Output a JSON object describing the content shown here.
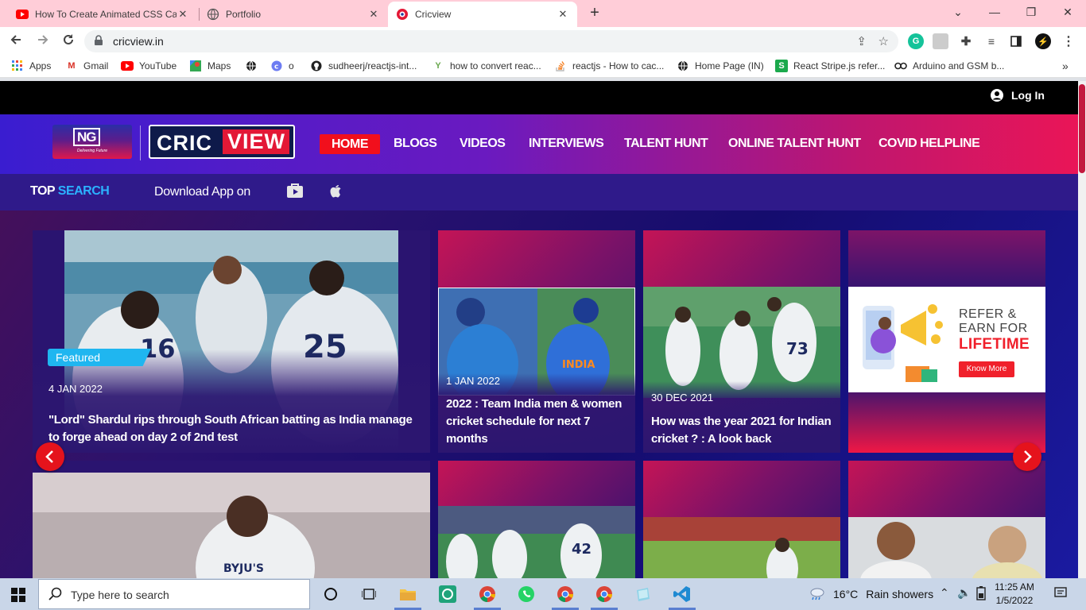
{
  "browser": {
    "tabs": [
      {
        "label": "How To Create Animated CSS Ca",
        "icon": "youtube-icon",
        "active": false
      },
      {
        "label": "Portfolio",
        "icon": "globe-icon",
        "active": false
      },
      {
        "label": "Cricview",
        "icon": "cricview-icon",
        "active": true
      }
    ],
    "url": "cricview.in",
    "bookmarks": [
      "Apps",
      "Gmail",
      "YouTube",
      "Maps",
      "",
      "o",
      "sudheerj/reactjs-int...",
      "how to convert reac...",
      "reactjs - How to cac...",
      "Home Page (IN)",
      "React Stripe.js refer...",
      "Arduino and GSM b..."
    ]
  },
  "site": {
    "login_label": "Log In",
    "logo_ng_text": "NG",
    "logo_ng_tagline": "Delivering Future",
    "logo_cric": "CRIC",
    "logo_view": "VIEW",
    "nav": [
      "HOME",
      "BLOGS",
      "VIDEOS",
      "INTERVIEWS",
      "TALENT HUNT",
      "ONLINE TALENT HUNT",
      "COVID HELPLINE"
    ],
    "topsearch_a": "TOP ",
    "topsearch_b": "SEARCH",
    "download_app": "Download App on",
    "featured_badge": "Featured",
    "cards": [
      {
        "date": "4 JAN 2022",
        "title": "\"Lord\" Shardul rips through South African batting as India manage to forge ahead on day 2 of 2nd test"
      },
      {
        "date": "1 JAN 2022",
        "title": "2022 : Team India men & women cricket schedule for next 7 months"
      },
      {
        "date": "30 DEC 2021",
        "title": "How was the year 2021 for Indian cricket ? : A look back"
      }
    ],
    "ad": {
      "line1": "REFER &",
      "line2": "EARN FOR",
      "line3": "LIFETIME",
      "button": "Know More"
    }
  },
  "taskbar": {
    "search_placeholder": "Type here to search",
    "temperature": "16°C",
    "weather": "Rain showers",
    "time": "11:25 AM",
    "date": "1/5/2022"
  },
  "colors": {
    "accent_red": "#e5131c",
    "nav_active": "#f10f1c",
    "featured": "#1fb6f0",
    "brand_purple": "#2f1a8a"
  }
}
